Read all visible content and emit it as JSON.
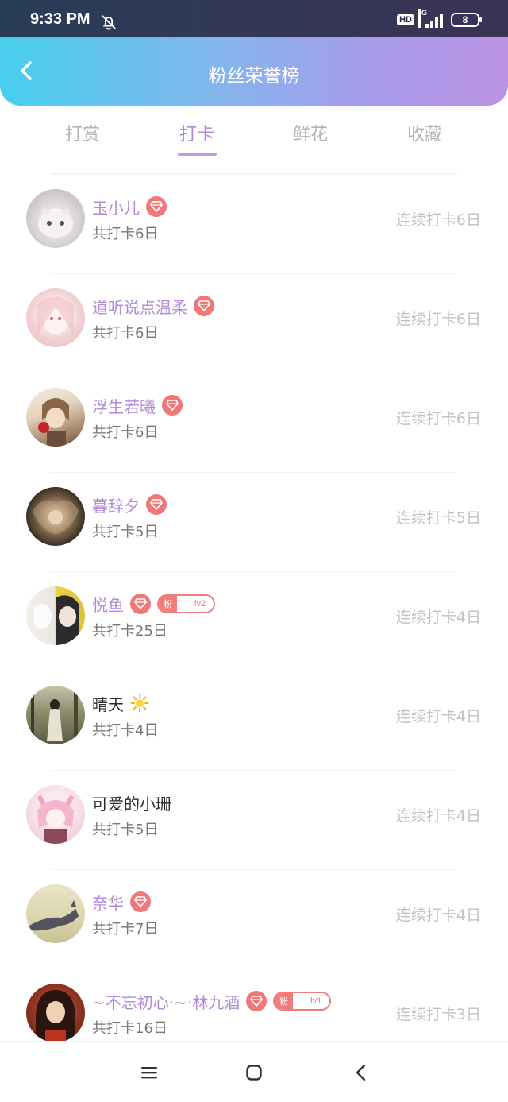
{
  "status": {
    "time": "9:33 PM",
    "hd": "HD",
    "network": "4G",
    "battery": "8"
  },
  "header": {
    "title": "粉丝荣誉榜"
  },
  "tabs": [
    {
      "label": "打赏"
    },
    {
      "label": "打卡"
    },
    {
      "label": "鲜花"
    },
    {
      "label": "收藏"
    }
  ],
  "active_tab": "打卡",
  "colors": {
    "accent": "#b08ad8",
    "badge": "#f07878",
    "header_start": "#47cfee",
    "header_end": "#bb93e4"
  },
  "list": [
    {
      "name": "玉小儿",
      "total": "共打卡6日",
      "streak": "连续打卡6日",
      "diamond": true
    },
    {
      "name": "道听说点温柔",
      "total": "共打卡6日",
      "streak": "连续打卡6日",
      "diamond": true
    },
    {
      "name": "浮生若曦",
      "total": "共打卡6日",
      "streak": "连续打卡6日",
      "diamond": true
    },
    {
      "name": "暮辞夕",
      "total": "共打卡5日",
      "streak": "连续打卡5日",
      "diamond": true
    },
    {
      "name": "悦鱼",
      "total": "共打卡25日",
      "streak": "连续打卡4日",
      "diamond": true,
      "fan_label": "粉",
      "fan_level": "lv2"
    },
    {
      "name": "晴天",
      "total": "共打卡4日",
      "streak": "连续打卡4日",
      "diamond": false,
      "emoji": "sun-icon"
    },
    {
      "name": "可爱的小珊",
      "total": "共打卡5日",
      "streak": "连续打卡4日",
      "diamond": false
    },
    {
      "name": "奈华",
      "total": "共打卡7日",
      "streak": "连续打卡4日",
      "diamond": true
    },
    {
      "name": "~不忘初心·~·林九酒",
      "total": "共打卡16日",
      "streak": "连续打卡3日",
      "diamond": true,
      "fan_label": "粉",
      "fan_level": "lv1"
    }
  ]
}
